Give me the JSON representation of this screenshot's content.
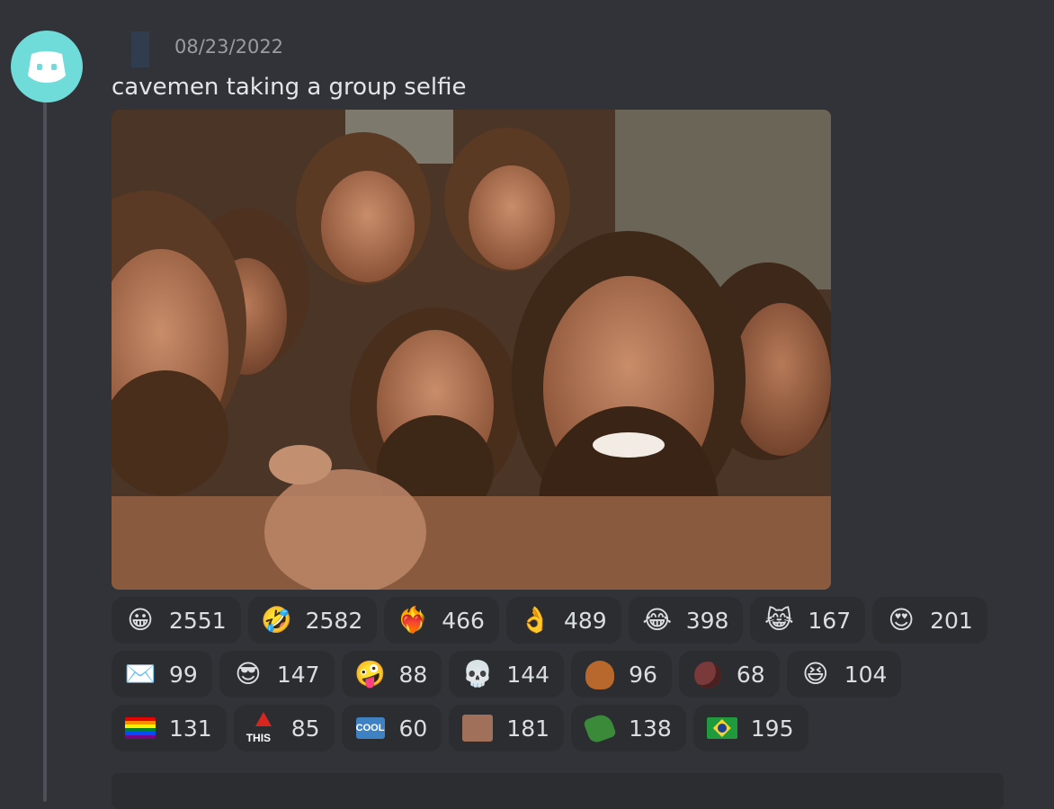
{
  "message": {
    "timestamp": "08/23/2022",
    "text": "cavemen taking a group selfie",
    "attachment_desc": "group selfie image"
  },
  "avatar": {
    "color": "#6fdcd9",
    "icon": "discord-bot-icon"
  },
  "reactions": [
    {
      "emoji": "😀",
      "icon": "grinning-face-icon",
      "count": "2551"
    },
    {
      "emoji": "🤣",
      "icon": "rolling-laughing-icon",
      "count": "2582"
    },
    {
      "emoji": "❤️‍🔥",
      "icon": "heart-on-fire-icon",
      "count": "466"
    },
    {
      "emoji": "👌",
      "icon": "ok-hand-icon",
      "count": "489"
    },
    {
      "emoji": "😂",
      "icon": "tears-of-joy-icon",
      "count": "398"
    },
    {
      "emoji": "😹",
      "icon": "cat-tears-of-joy-icon",
      "count": "167"
    },
    {
      "emoji": "😍",
      "icon": "heart-eyes-icon",
      "count": "201"
    },
    {
      "emoji": "✉️",
      "icon": "envelope-icon",
      "count": "99"
    },
    {
      "emoji": "😎",
      "icon": "sunglasses-face-icon",
      "count": "147"
    },
    {
      "emoji": "🤪",
      "icon": "zany-face-icon",
      "count": "88"
    },
    {
      "emoji": "💀",
      "icon": "skull-icon",
      "count": "144"
    },
    {
      "emoji": "",
      "icon": "orangutan-custom-icon",
      "count": "96"
    },
    {
      "emoji": "",
      "icon": "dark-blob-custom-icon",
      "count": "68"
    },
    {
      "emoji": "😆",
      "icon": "laughing-squint-icon",
      "count": "104"
    },
    {
      "emoji": "",
      "icon": "pride-flag-icon",
      "count": "131"
    },
    {
      "emoji": "",
      "icon": "this-arrow-custom-icon",
      "count": "85"
    },
    {
      "emoji": "",
      "icon": "cool-badge-icon",
      "count": "60"
    },
    {
      "emoji": "",
      "icon": "face-sticker-custom-icon",
      "count": "181"
    },
    {
      "emoji": "",
      "icon": "green-blob-custom-icon",
      "count": "138"
    },
    {
      "emoji": "",
      "icon": "brazil-flag-icon",
      "count": "195"
    }
  ],
  "custom_labels": {
    "this": "THIS",
    "cool": "COOL"
  }
}
